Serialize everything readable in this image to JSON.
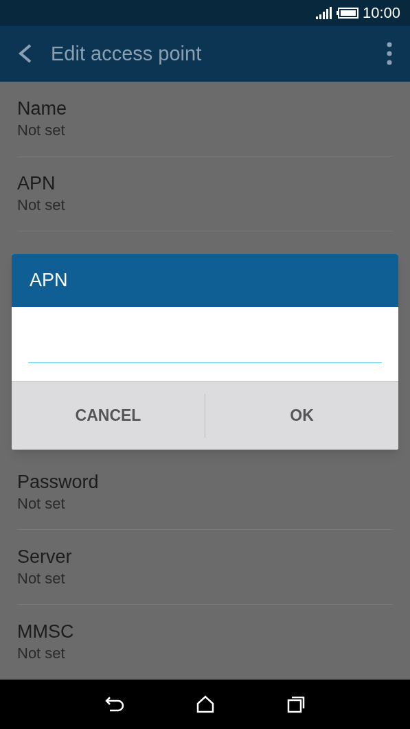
{
  "status_bar": {
    "time": "10:00"
  },
  "toolbar": {
    "title": "Edit access point"
  },
  "settings": [
    {
      "label": "Name",
      "value": "Not set"
    },
    {
      "label": "APN",
      "value": "Not set"
    },
    {
      "label": "Password",
      "value": "Not set"
    },
    {
      "label": "Server",
      "value": "Not set"
    },
    {
      "label": "MMSC",
      "value": "Not set"
    }
  ],
  "dialog": {
    "title": "APN",
    "buttons": [
      "CANCEL",
      "OK"
    ]
  }
}
